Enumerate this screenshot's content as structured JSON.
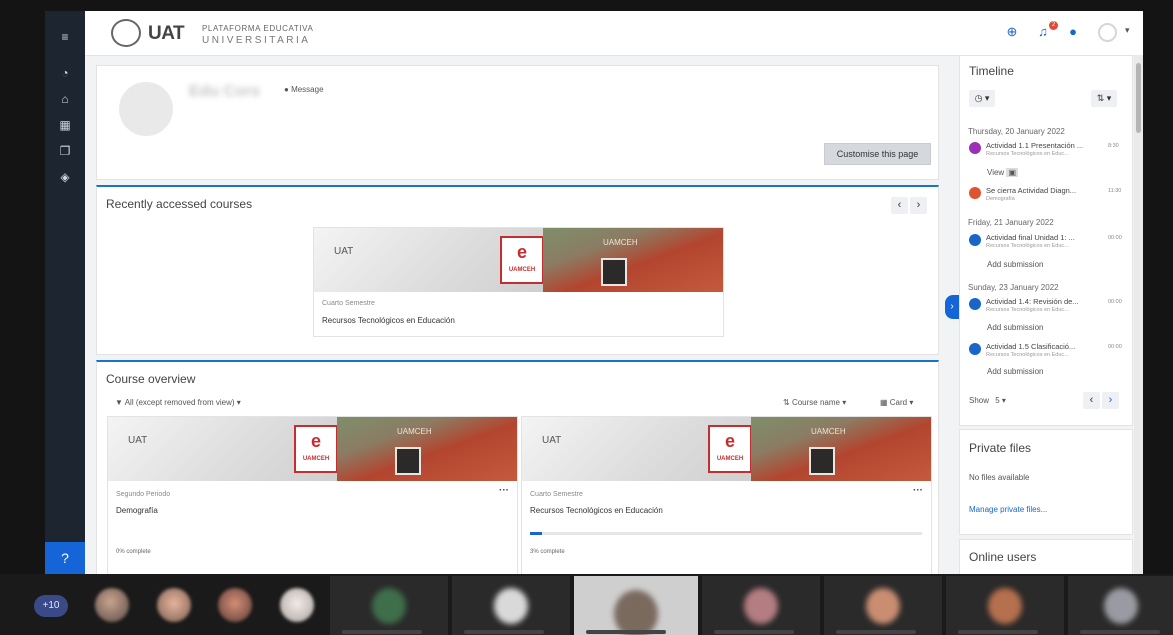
{
  "app": {
    "logo_mark": "UAT",
    "logo_text": "UAT",
    "logo_sub1": "PLATAFORMA EDUCATIVA",
    "logo_sub2": "UNIVERSITARIA"
  },
  "topbar": {
    "icons": [
      "globe-icon",
      "bell-icon",
      "chat-icon",
      "user-avatar-icon"
    ],
    "notification_count": "2",
    "caret": "▾"
  },
  "leftnav": {
    "items": [
      "menu-icon",
      "dashboard-icon",
      "home-icon",
      "calendar-icon",
      "files-icon",
      "courses-icon"
    ],
    "help_icon": "question-icon"
  },
  "profile": {
    "user_name": "Edu Cors",
    "message_label": "Message",
    "customise_label": "Customise this page"
  },
  "recent": {
    "title": "Recently accessed courses",
    "prev": "‹",
    "next": "›",
    "card": {
      "category": "Cuarto Semestre",
      "name": "Recursos Tecnológicos en Educación"
    }
  },
  "banner": {
    "logo_text": "UAT",
    "shield_letter": "e",
    "shield_caption": "UAMCEH",
    "sign_text": "UAMCEH"
  },
  "overview": {
    "title": "Course overview",
    "filter": "All (except removed from view)",
    "sort": "Course name",
    "view": "Card",
    "courses": [
      {
        "category": "Segundo Periodo",
        "name": "Demografía",
        "progress_text": "0% complete",
        "progress": 0.0
      },
      {
        "category": "Cuarto Semestre",
        "name": "Recursos Tecnológicos en Educación",
        "progress_text": "3% complete",
        "progress": 0.03
      }
    ]
  },
  "timeline": {
    "title": "Timeline",
    "groups": [
      {
        "date": "Thursday, 20 January 2022",
        "events": [
          {
            "title": "Actividad 1.1 Presentación ...",
            "course": "Recursos Tecnológicos en Educ...",
            "time": "8:30",
            "action": "View",
            "color": "#9b30b7"
          },
          {
            "title": "Se cierra Actividad Diagn...",
            "course": "Demografía",
            "time": "11:30",
            "action": "",
            "color": "#e0532f"
          }
        ]
      },
      {
        "date": "Friday, 21 January 2022",
        "events": [
          {
            "title": "Actividad final Unidad 1: ...",
            "course": "Recursos Tecnológicos en Educ...",
            "time": "00:00",
            "action": "Add submission",
            "color": "#1a66c6"
          }
        ]
      },
      {
        "date": "Sunday, 23 January 2022",
        "events": [
          {
            "title": "Actividad 1.4: Revisión de...",
            "course": "Recursos Tecnológicos en Educ...",
            "time": "00:00",
            "action": "Add submission",
            "color": "#1a66c6"
          },
          {
            "title": "Actividad 1.5 Clasificació...",
            "course": "Recursos Tecnológicos en Educ...",
            "time": "00:00",
            "action": "Add submission",
            "color": "#1a66c6"
          }
        ]
      }
    ],
    "show_label": "Show",
    "show_value": "5"
  },
  "private_files": {
    "title": "Private files",
    "empty": "No files available",
    "manage": "Manage private files..."
  },
  "online_users": {
    "title": "Online users"
  },
  "meeting": {
    "more": "+10"
  }
}
